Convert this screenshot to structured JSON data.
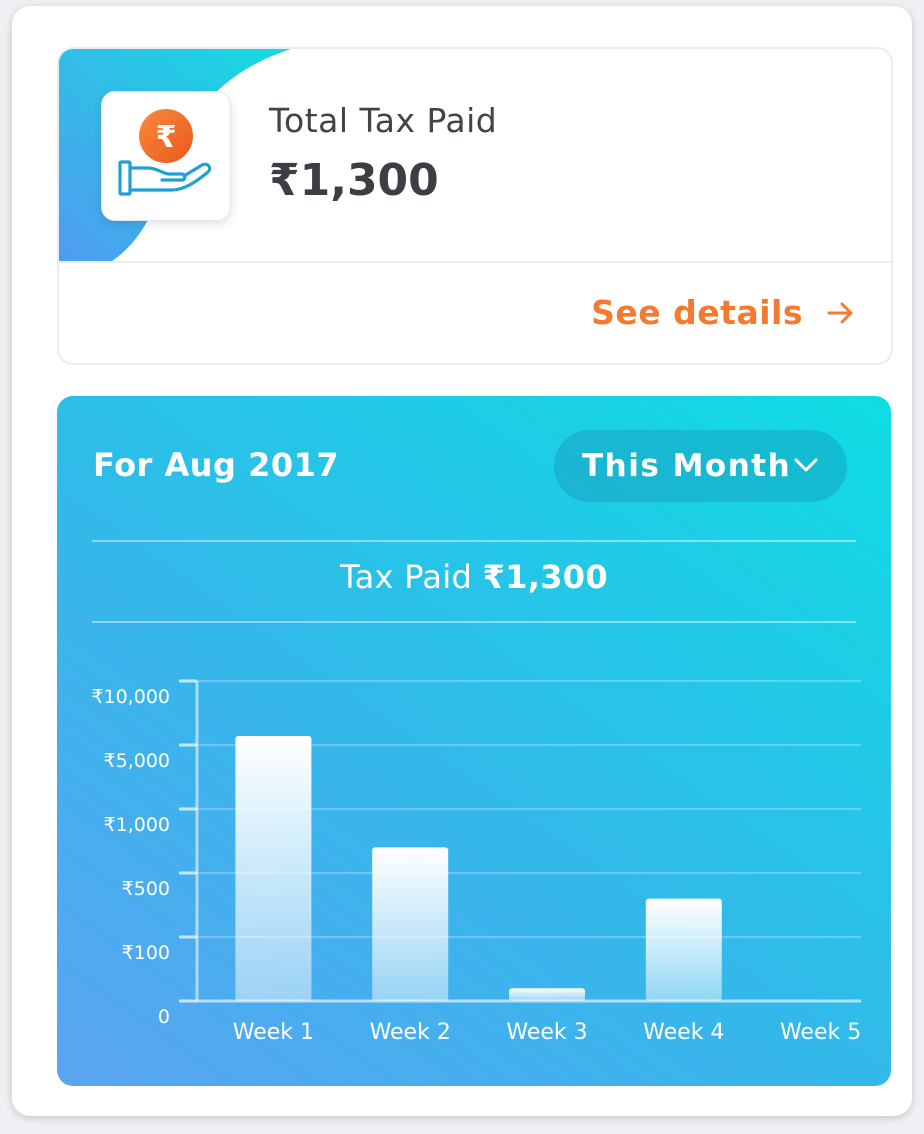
{
  "summary": {
    "label": "Total Tax Paid",
    "amount": "₹1,300",
    "icon": "rupee-in-hand-icon",
    "see_details_label": "See details",
    "accent_color": "#f47a2f"
  },
  "chart_panel": {
    "period_label": "For Aug 2017",
    "period_select": {
      "selected": "This Month"
    },
    "total_label": "Tax Paid",
    "total_value": "₹1,300"
  },
  "chart_data": {
    "type": "bar",
    "categories": [
      "Week 1",
      "Week 2",
      "Week 3",
      "Week 4",
      "Week 5"
    ],
    "values": [
      5700,
      700,
      20,
      340,
      0
    ],
    "y_scale": "categorical-breaks",
    "y_ticks": [
      {
        "value": 0,
        "label": "0"
      },
      {
        "value": 100,
        "label": "₹100"
      },
      {
        "value": 500,
        "label": "₹500"
      },
      {
        "value": 1000,
        "label": "₹1,000"
      },
      {
        "value": 5000,
        "label": "₹5,000"
      },
      {
        "value": 10000,
        "label": "₹10,000"
      }
    ],
    "grid": true
  }
}
